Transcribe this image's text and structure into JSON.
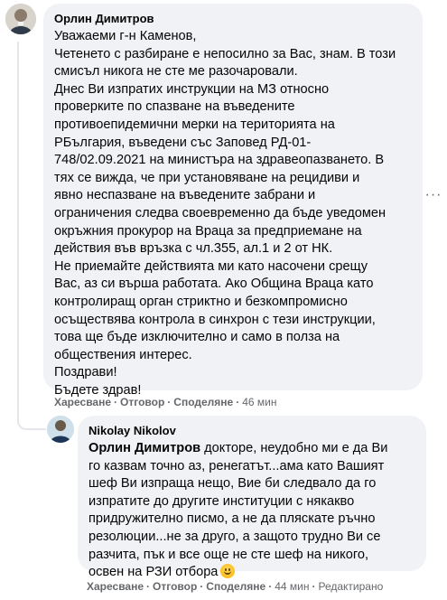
{
  "comments": [
    {
      "author": "Орлин Димитров",
      "lines": [
        "Уважаеми г-н Каменов,",
        "Четенето с разбиране е непосилно за Вас, знам. В този",
        "смисъл никога не сте ме разочаровали.",
        "Днес Ви изпратих инструкции на МЗ относно",
        "проверките по спазване на въведените",
        "противоепидемични мерки на територията на",
        "РБългария, въведени със Заповед РД-01-",
        "748/02.09.2021 на министъра на здравеопазването. В",
        "тях се вижда, че при установяване на рецидиви и",
        "явно неспазване на въведените забрани и",
        "ограничения следва своевременно да бъде уведомен",
        "окръжния прокурор на Враца за предприемане на",
        "действия във връзка с чл.355, ал.1 и 2 от НК.",
        "Не приемайте действията ми като насочени срещу",
        "Вас, аз си върша работата. Ако Община Враца като",
        "контролиращ орган стриктно и безкомпромисно",
        "осъществява контрола в синхрон с тези инструкции,",
        "това ще бъде изключително и само в полза на",
        "обществения интерес.",
        "Поздрави!",
        "Бъдете здрав!"
      ],
      "actions": {
        "like": "Харесване",
        "reply": "Отговор",
        "share": "Споделяне",
        "time": "46 мин"
      }
    },
    {
      "author": "Nikolay Nikolov",
      "mention": "Орлин Димитров",
      "first_line_rest": " докторе, неудобно ми е да Ви",
      "lines": [
        "го казвам точно аз, ренегатът...ама като Вашият",
        "шеф Ви изпраща нещо, Вие би следвало да го",
        "изпратите до другите институции с някакво",
        "придружително писмо, а не да пляскате ръчно",
        "резолюции...не за друго, а защото трудно Ви се",
        "разчита, пък и все още не сте шеф на никого,",
        "освен на РЗИ отбора"
      ],
      "emoji": "smile-emoji",
      "actions": {
        "like": "Харесване",
        "reply": "Отговор",
        "share": "Споделяне",
        "time": "44 мин",
        "edited": "Редактирано"
      }
    }
  ],
  "ui": {
    "more_glyph": "···",
    "dot": "·"
  }
}
